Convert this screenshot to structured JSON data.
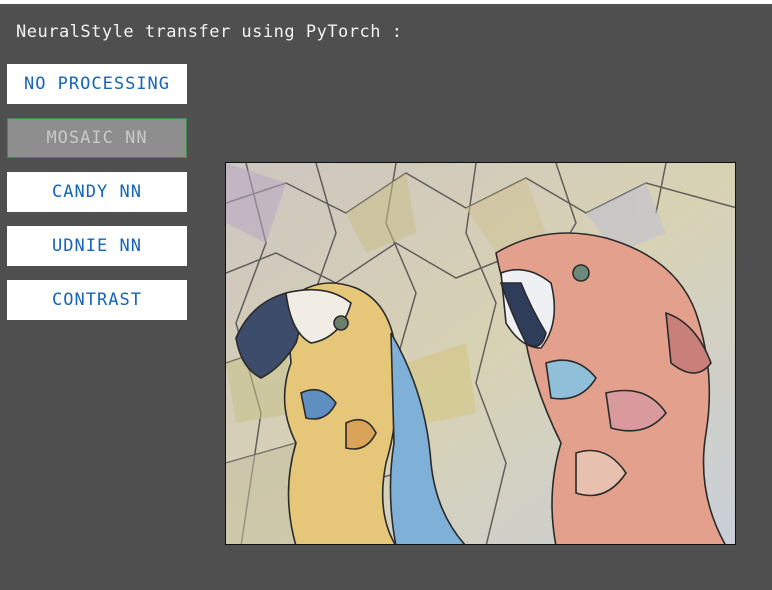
{
  "window": {
    "title": "NeuralStyle transfer using PyTorch :"
  },
  "buttons": [
    {
      "label": "NO PROCESSING",
      "state": "normal"
    },
    {
      "label": "MOSAIC NN",
      "state": "active"
    },
    {
      "label": "CANDY NN",
      "state": "normal"
    },
    {
      "label": "UDNIE NN",
      "state": "normal"
    },
    {
      "label": "CONTRAST",
      "state": "normal"
    }
  ],
  "image": {
    "subject": "two macaw parrots, mosaic stained-glass style"
  },
  "colors": {
    "background": "#4f4f4f",
    "button_bg": "#ffffff",
    "button_text": "#1565b8",
    "active_button_bg": "#8e8e8e",
    "active_button_text": "#c9c9c9"
  }
}
